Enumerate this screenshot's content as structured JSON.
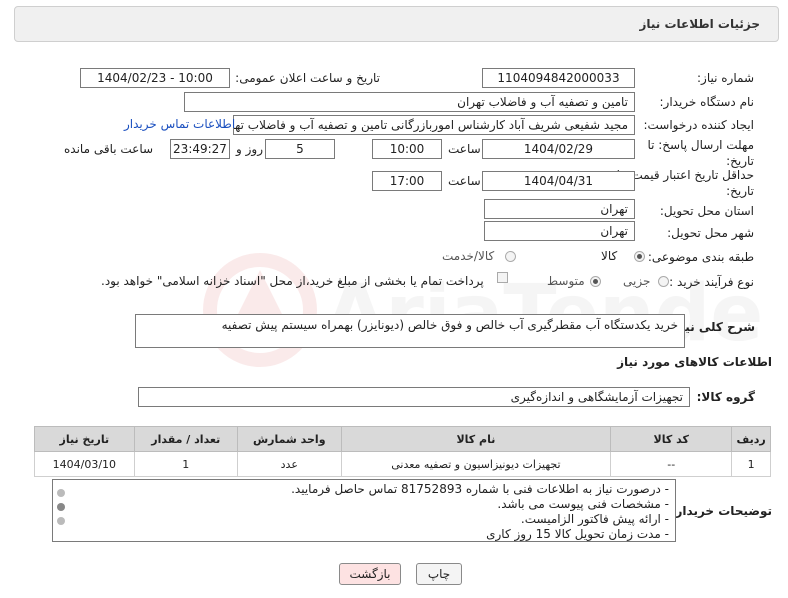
{
  "header": {
    "title": "جزئیات اطلاعات نیاز"
  },
  "fields": {
    "need_number_label": "شماره نیاز:",
    "need_number": "1104094842000033",
    "announce_label": "تاریخ و ساعت اعلان عمومی:",
    "announce_value": "1404/02/23 - 10:00",
    "buyer_org_label": "نام دستگاه خریدار:",
    "buyer_org": "تامین و تصفیه آب و فاضلاب تهران",
    "creator_label": "ایجاد کننده درخواست:",
    "creator": "مجید شفیعی شریف آباد کارشناس اموربازرگانی تامین و تصفیه آب و فاضلاب تهرا",
    "buyer_contact_link": "اطلاعات تماس خریدار",
    "reply_deadline_label": "مهلت ارسال پاسخ: تا تاریخ:",
    "reply_date": "1404/02/29",
    "time_label": "ساعت",
    "reply_time": "10:00",
    "days_value": "5",
    "days_label": "روز و",
    "remaining_time": "23:49:27",
    "remaining_label": "ساعت باقی مانده",
    "price_validity_label": "حداقل تاریخ اعتبار قیمت: تا تاریخ:",
    "price_date": "1404/04/31",
    "price_time": "17:00",
    "province_label": "استان محل تحویل:",
    "province": "تهران",
    "city_label": "شهر محل تحویل:",
    "city": "تهران",
    "category_label": "طبقه بندی موضوعی:",
    "category_goods": "کالا",
    "category_goods_service": "کالا/خدمت",
    "process_label": "نوع فرآیند خرید :",
    "process_partial": "جزیی",
    "process_medium": "متوسط",
    "payment_note": "پرداخت تمام یا بخشی از مبلغ خرید،از محل \"اسناد خزانه اسلامی\" خواهد بود."
  },
  "description": {
    "label": "شرح کلی نیاز:",
    "text": "خرید یکدستگاه آب مقطرگیری آب خالص و فوق خالص (دیونایزر) بهمراه سیستم پیش تصفیه"
  },
  "goods": {
    "section_title": "اطلاعات کالاهای مورد نیاز",
    "group_label": "گروه کالا:",
    "group_value": "تجهیزات آزمایشگاهی و اندازه‌گیری",
    "columns": [
      "ردیف",
      "کد کالا",
      "نام کالا",
      "واحد شمارش",
      "تعداد / مقدار",
      "تاریخ نیاز"
    ],
    "rows": [
      [
        "1",
        "--",
        "تجهیزات دیونیزاسیون و تصفیه معدنی",
        "عدد",
        "1",
        "1404/03/10"
      ]
    ]
  },
  "buyer_notes": {
    "label": "توضیحات خریدار:",
    "lines": [
      "- درصورت نیاز به اطلاعات فنی با شماره 81752893 تماس حاصل فرمایید.",
      "- مشخصات فنی پیوست می باشد.",
      "- ارائه پیش فاکتور الزامیست.",
      "- مدت زمان تحویل کالا 15 روز کاری"
    ]
  },
  "buttons": {
    "print": "چاپ",
    "back": "بازگشت"
  },
  "watermark": "AriaTender.neT",
  "colors": {
    "link": "#1a4fbf",
    "back_button_bg": "#fde2e2",
    "header_bg": "#f0f0f0",
    "table_header_bg": "#d9d9d9"
  }
}
